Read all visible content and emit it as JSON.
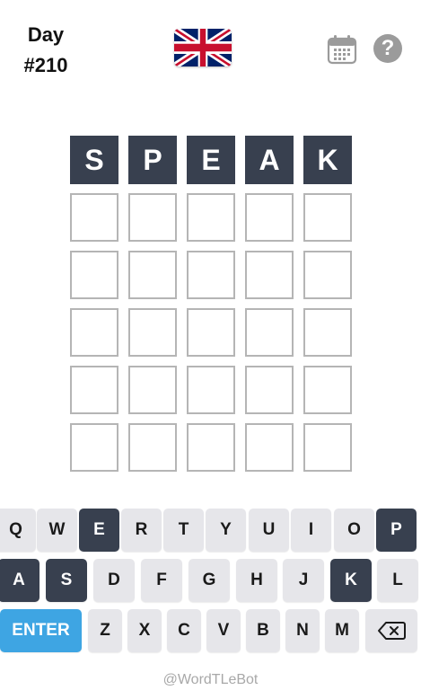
{
  "header": {
    "day_label": "Day",
    "day_number": "#210",
    "flag_icon": "uk-flag-icon",
    "calendar_icon": "calendar-icon",
    "help_icon_label": "?"
  },
  "board": {
    "rows": [
      [
        "S",
        "P",
        "E",
        "A",
        "K"
      ],
      [
        "",
        "",
        "",
        "",
        ""
      ],
      [
        "",
        "",
        "",
        "",
        ""
      ],
      [
        "",
        "",
        "",
        "",
        ""
      ],
      [
        "",
        "",
        "",
        "",
        ""
      ],
      [
        "",
        "",
        "",
        "",
        ""
      ]
    ]
  },
  "keyboard": {
    "row1": [
      "Q",
      "W",
      "E",
      "R",
      "T",
      "Y",
      "U",
      "I",
      "O",
      "P"
    ],
    "row2": [
      "A",
      "S",
      "D",
      "F",
      "G",
      "H",
      "J",
      "K",
      "L"
    ],
    "row3": [
      "ENTER",
      "Z",
      "X",
      "C",
      "V",
      "B",
      "N",
      "M",
      "backspace"
    ],
    "used_letters": [
      "E",
      "P",
      "A",
      "S",
      "K"
    ]
  },
  "colors": {
    "tile_filled": "#38404f",
    "enter_key": "#3ea5e3",
    "key_default": "#e6e6ea"
  },
  "footer": {
    "credit": "@WordTLeBot"
  }
}
